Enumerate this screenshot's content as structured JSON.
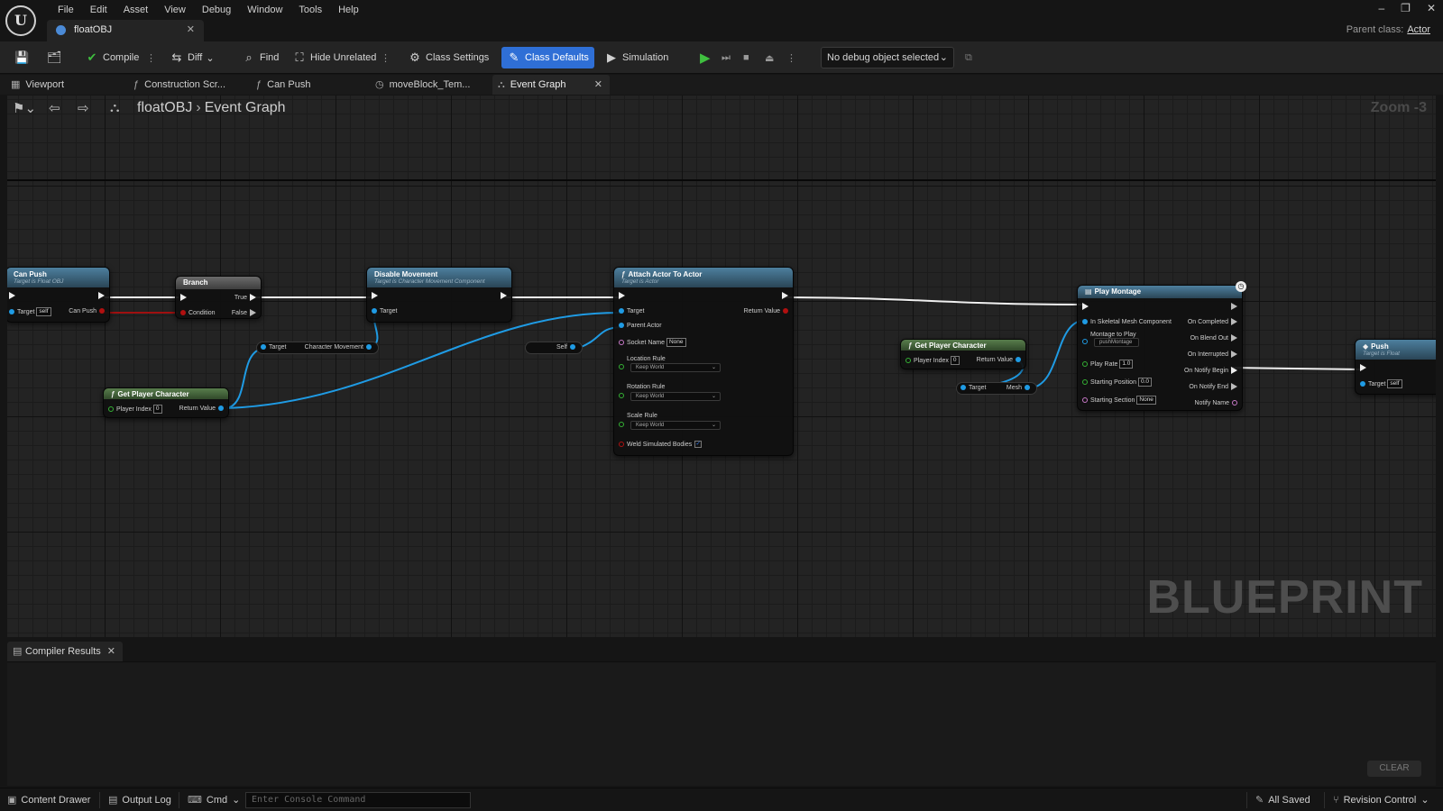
{
  "window": {
    "menu": [
      "File",
      "Edit",
      "Asset",
      "View",
      "Debug",
      "Window",
      "Tools",
      "Help"
    ],
    "asset_tab": "floatOBJ",
    "parent_class_label": "Parent class:",
    "parent_class_value": "Actor",
    "controls": [
      "–",
      "❐",
      "✕"
    ]
  },
  "toolbar": {
    "compile": "Compile",
    "diff": "Diff",
    "find": "Find",
    "hide_unrelated": "Hide Unrelated",
    "class_settings": "Class Settings",
    "class_defaults": "Class Defaults",
    "simulation": "Simulation",
    "debug_object": "No debug object selected"
  },
  "doc_tabs": {
    "viewport": "Viewport",
    "construction_script": "Construction Scr...",
    "can_push": "Can Push",
    "move_block": "moveBlock_Tem...",
    "event_graph": "Event Graph"
  },
  "graph": {
    "breadcrumb_root": "floatOBJ",
    "breadcrumb_leaf": "Event Graph",
    "zoom": "Zoom -3",
    "watermark": "BLUEPRINT",
    "nodes": {
      "can_push": {
        "title": "Can Push",
        "subtitle": "Target is Float OBJ",
        "target": "Target",
        "target_value": "self",
        "out": "Can Push"
      },
      "branch": {
        "title": "Branch",
        "condition": "Condition",
        "true": "True",
        "false": "False"
      },
      "disable_movement": {
        "title": "Disable Movement",
        "subtitle": "Target is Character Movement Component",
        "target": "Target"
      },
      "char_movement": {
        "target": "Target",
        "out": "Character Movement"
      },
      "get_player_1": {
        "title": "Get Player Character",
        "player_index": "Player Index",
        "player_index_value": "0",
        "return_value": "Return Value"
      },
      "self_node": {
        "label": "Self"
      },
      "attach": {
        "title": "Attach Actor To Actor",
        "subtitle": "Target is Actor",
        "target": "Target",
        "return_value": "Return Value",
        "parent_actor": "Parent Actor",
        "socket_name": "Socket Name",
        "socket_value": "None",
        "location_rule": "Location Rule",
        "location_value": "Keep World",
        "rotation_rule": "Rotation Rule",
        "rotation_value": "Keep World",
        "scale_rule": "Scale Rule",
        "scale_value": "Keep World",
        "weld": "Weld Simulated Bodies"
      },
      "get_player_2": {
        "title": "Get Player Character",
        "player_index": "Player Index",
        "player_index_value": "0",
        "return_value": "Return Value"
      },
      "mesh_node": {
        "target": "Target",
        "out": "Mesh"
      },
      "play_montage": {
        "title": "Play Montage",
        "in_skeletal": "In Skeletal Mesh Component",
        "montage": "Montage to Play",
        "montage_value": "pushMontage",
        "play_rate": "Play Rate",
        "play_rate_value": "1.0",
        "start_pos": "Starting Position",
        "start_pos_value": "0.0",
        "start_section": "Starting Section",
        "start_section_value": "None",
        "on_completed": "On Completed",
        "on_blend_out": "On Blend Out",
        "on_interrupted": "On Interrupted",
        "on_notify_begin": "On Notify Begin",
        "on_notify_end": "On Notify End",
        "notify_name": "Notify Name"
      },
      "push": {
        "title": "Push",
        "subtitle": "Target is Float",
        "target": "Target",
        "target_value": "self"
      }
    }
  },
  "bottom": {
    "compiler_results": "Compiler Results",
    "clear": "CLEAR"
  },
  "status": {
    "content_drawer": "Content Drawer",
    "output_log": "Output Log",
    "cmd": "Cmd",
    "console_placeholder": "Enter Console Command",
    "saved": "All Saved",
    "revision_control": "Revision Control"
  }
}
